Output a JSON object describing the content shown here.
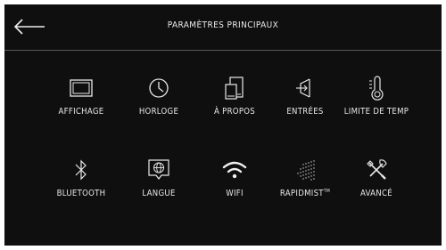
{
  "header": {
    "title": "PARAMÈTRES PRINCIPAUX",
    "back_icon": "arrow-left-icon"
  },
  "menu": {
    "row1": [
      {
        "label": "AFFICHAGE",
        "icon": "display-icon"
      },
      {
        "label": "HORLOGE",
        "icon": "clock-icon"
      },
      {
        "label": "À PROPOS",
        "icon": "devices-icon"
      },
      {
        "label": "ENTRÉES",
        "icon": "input-icon"
      },
      {
        "label": "LIMITE DE TEMP",
        "icon": "thermometer-icon"
      }
    ],
    "row2": [
      {
        "label": "BLUETOOTH",
        "icon": "bluetooth-icon"
      },
      {
        "label": "LANGUE",
        "icon": "globe-speech-icon"
      },
      {
        "label": "WIFI",
        "icon": "wifi-icon"
      },
      {
        "label": "RAPIDMIST",
        "label_suffix": "TM",
        "icon": "mist-icon"
      },
      {
        "label": "AVANCÉ",
        "icon": "tools-icon"
      }
    ]
  },
  "colors": {
    "background": "#0f0f0f",
    "frame": "#ffffff",
    "text": "#e8e8e8",
    "divider": "#5a5a5a"
  }
}
